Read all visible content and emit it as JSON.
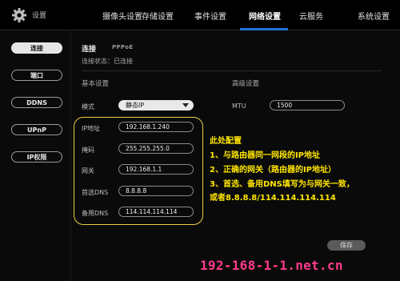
{
  "header": {
    "app_title": "设置",
    "tabs": [
      "摄像头设置",
      "存储设置",
      "事件设置",
      "网络设置",
      "云服务",
      "系统设置"
    ],
    "active_tab": "网络设置"
  },
  "sidebar": {
    "items": [
      {
        "label": "连接",
        "active": true
      },
      {
        "label": "端口",
        "active": false
      },
      {
        "label": "DDNS",
        "active": false
      },
      {
        "label": "UPnP",
        "active": false
      },
      {
        "label": "IP权限",
        "active": false
      }
    ]
  },
  "main": {
    "section_title": "连接",
    "pppoe_label": "PPPoE",
    "status_text": "连接状态：已连接",
    "basic_settings": "基本设置",
    "advanced_settings": "高级设置",
    "mode_label": "模式",
    "mode_value": "静态IP",
    "mtu_label": "MTU",
    "mtu_value": "1500",
    "fields": [
      {
        "label": "IP地址",
        "value": "192.168.1.240"
      },
      {
        "label": "掩码",
        "value": "255.255.255.0"
      },
      {
        "label": "网关",
        "value": "192.168.1.1"
      },
      {
        "label": "首选DNS",
        "value": "8.8.8.8"
      },
      {
        "label": "备用DNS",
        "value": "114.114.114.114"
      }
    ],
    "save_label": "保存"
  },
  "annotation": {
    "lines": [
      "此处配置",
      "1、与路由器同一网段的IP地址",
      "2、正确的网关（路由器的IP地址）",
      "3、首选、备用DNS填写为与网关一致，",
      "或者8.8.8.8/114.114.114.114"
    ],
    "color": "#ffe600"
  },
  "watermark": "192-168-1-1.net.cn",
  "colors": {
    "accent": "#1f74d8",
    "highlight_border": "#e8cf43",
    "watermark": "#ff3b8c"
  }
}
